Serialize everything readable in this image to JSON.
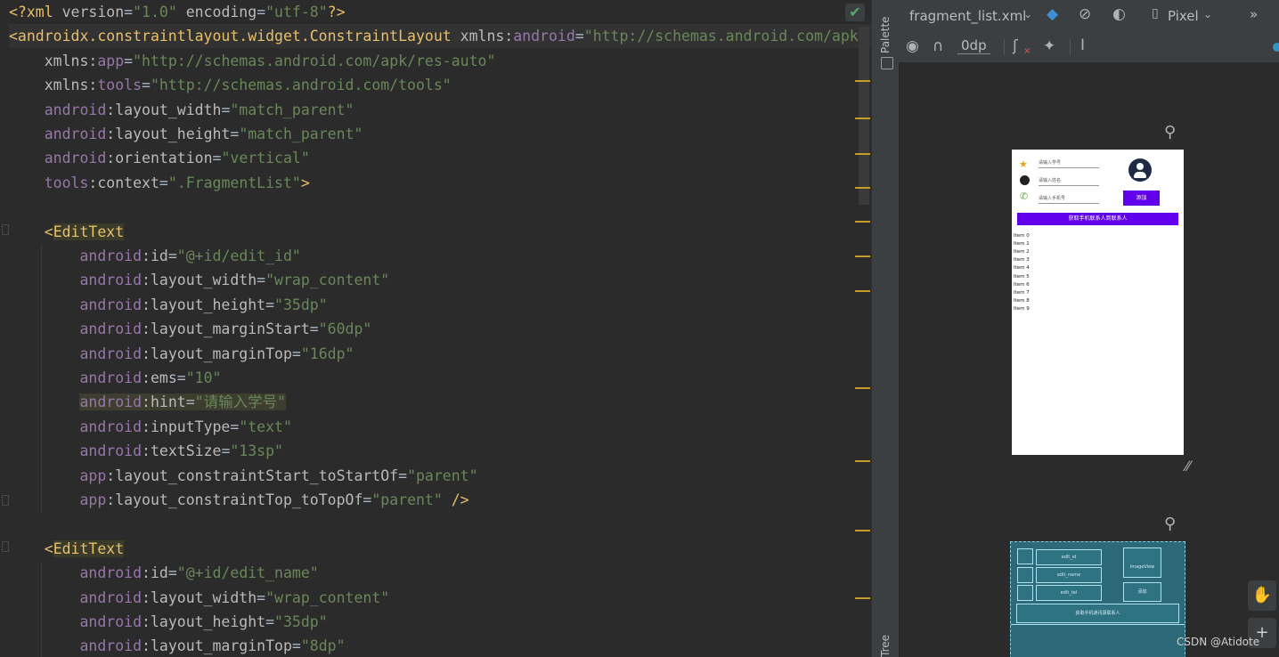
{
  "editor": {
    "lines": [
      {
        "parts": [
          [
            "tag",
            "<?xml "
          ],
          [
            "attr",
            "version"
          ],
          [
            "eq",
            "="
          ],
          [
            "val",
            "\"1.0\""
          ],
          [
            "eq",
            " "
          ],
          [
            "attr",
            "encoding"
          ],
          [
            "eq",
            "="
          ],
          [
            "val",
            "\"utf-8\""
          ],
          [
            "tag",
            "?>"
          ]
        ]
      },
      {
        "parts": [
          [
            "tag",
            "<androidx.constraintlayout.widget.ConstraintLayout "
          ],
          [
            "attr",
            "xmlns:"
          ],
          [
            "ns",
            "android"
          ],
          [
            "eq",
            "="
          ],
          [
            "val",
            "\"http://schemas.android.com/apk/"
          ]
        ]
      },
      {
        "parts": [
          [
            "eq",
            "    "
          ],
          [
            "attr",
            "xmlns:"
          ],
          [
            "ns",
            "app"
          ],
          [
            "eq",
            "="
          ],
          [
            "val",
            "\"http://schemas.android.com/apk/res-auto\""
          ]
        ]
      },
      {
        "parts": [
          [
            "eq",
            "    "
          ],
          [
            "attr",
            "xmlns:"
          ],
          [
            "ns",
            "tools"
          ],
          [
            "eq",
            "="
          ],
          [
            "val",
            "\"http://schemas.android.com/tools\""
          ]
        ]
      },
      {
        "parts": [
          [
            "eq",
            "    "
          ],
          [
            "ns",
            "android"
          ],
          [
            "attr",
            ":layout_width"
          ],
          [
            "eq",
            "="
          ],
          [
            "val",
            "\"match_parent\""
          ]
        ]
      },
      {
        "parts": [
          [
            "eq",
            "    "
          ],
          [
            "ns",
            "android"
          ],
          [
            "attr",
            ":layout_height"
          ],
          [
            "eq",
            "="
          ],
          [
            "val",
            "\"match_parent\""
          ]
        ]
      },
      {
        "parts": [
          [
            "eq",
            "    "
          ],
          [
            "ns",
            "android"
          ],
          [
            "attr",
            ":orientation"
          ],
          [
            "eq",
            "="
          ],
          [
            "val",
            "\"vertical\""
          ]
        ]
      },
      {
        "parts": [
          [
            "eq",
            "    "
          ],
          [
            "ns",
            "tools"
          ],
          [
            "attr",
            ":context"
          ],
          [
            "eq",
            "="
          ],
          [
            "val",
            "\".FragmentList\""
          ],
          [
            "tag",
            ">"
          ]
        ]
      },
      {
        "parts": []
      },
      {
        "parts": [
          [
            "eq",
            "    "
          ],
          [
            "tag",
            "<"
          ],
          [
            "tagname-hl",
            "EditText"
          ]
        ]
      },
      {
        "parts": [
          [
            "eq",
            "        "
          ],
          [
            "ns",
            "android"
          ],
          [
            "attr",
            ":id"
          ],
          [
            "eq",
            "="
          ],
          [
            "val",
            "\"@+id/edit_id\""
          ]
        ]
      },
      {
        "parts": [
          [
            "eq",
            "        "
          ],
          [
            "ns",
            "android"
          ],
          [
            "attr",
            ":layout_width"
          ],
          [
            "eq",
            "="
          ],
          [
            "val",
            "\"wrap_content\""
          ]
        ]
      },
      {
        "parts": [
          [
            "eq",
            "        "
          ],
          [
            "ns",
            "android"
          ],
          [
            "attr",
            ":layout_height"
          ],
          [
            "eq",
            "="
          ],
          [
            "val",
            "\"35dp\""
          ]
        ]
      },
      {
        "parts": [
          [
            "eq",
            "        "
          ],
          [
            "ns",
            "android"
          ],
          [
            "attr",
            ":layout_marginStart"
          ],
          [
            "eq",
            "="
          ],
          [
            "val",
            "\"60dp\""
          ]
        ]
      },
      {
        "parts": [
          [
            "eq",
            "        "
          ],
          [
            "ns",
            "android"
          ],
          [
            "attr",
            ":layout_marginTop"
          ],
          [
            "eq",
            "="
          ],
          [
            "val",
            "\"16dp\""
          ]
        ]
      },
      {
        "parts": [
          [
            "eq",
            "        "
          ],
          [
            "ns",
            "android"
          ],
          [
            "attr",
            ":ems"
          ],
          [
            "eq",
            "="
          ],
          [
            "val",
            "\"10\""
          ]
        ]
      },
      {
        "parts": [
          [
            "eq",
            "        "
          ],
          [
            "ns hint-hl",
            "android"
          ],
          [
            "attr hint-hl",
            ":hint"
          ],
          [
            "eq hint-hl",
            "="
          ],
          [
            "val hint-hl",
            "\"请输入学号\""
          ]
        ]
      },
      {
        "parts": [
          [
            "eq",
            "        "
          ],
          [
            "ns",
            "android"
          ],
          [
            "attr",
            ":inputType"
          ],
          [
            "eq",
            "="
          ],
          [
            "val",
            "\"text\""
          ]
        ]
      },
      {
        "parts": [
          [
            "eq",
            "        "
          ],
          [
            "ns",
            "android"
          ],
          [
            "attr",
            ":textSize"
          ],
          [
            "eq",
            "="
          ],
          [
            "val",
            "\"13sp\""
          ]
        ]
      },
      {
        "parts": [
          [
            "eq",
            "        "
          ],
          [
            "ns",
            "app"
          ],
          [
            "attr",
            ":layout_constraintStart_toStartOf"
          ],
          [
            "eq",
            "="
          ],
          [
            "val",
            "\"parent\""
          ]
        ]
      },
      {
        "parts": [
          [
            "eq",
            "        "
          ],
          [
            "ns",
            "app"
          ],
          [
            "attr",
            ":layout_constraintTop_toTopOf"
          ],
          [
            "eq",
            "="
          ],
          [
            "val",
            "\"parent\""
          ],
          [
            "eq",
            " "
          ],
          [
            "tag",
            "/>"
          ]
        ]
      },
      {
        "parts": []
      },
      {
        "parts": [
          [
            "eq",
            "    "
          ],
          [
            "tag",
            "<"
          ],
          [
            "tagname-hl",
            "EditText"
          ]
        ]
      },
      {
        "parts": [
          [
            "eq",
            "        "
          ],
          [
            "ns",
            "android"
          ],
          [
            "attr",
            ":id"
          ],
          [
            "eq",
            "="
          ],
          [
            "val",
            "\"@+id/edit_name\""
          ]
        ]
      },
      {
        "parts": [
          [
            "eq",
            "        "
          ],
          [
            "ns",
            "android"
          ],
          [
            "attr",
            ":layout_width"
          ],
          [
            "eq",
            "="
          ],
          [
            "val",
            "\"wrap_content\""
          ]
        ]
      },
      {
        "parts": [
          [
            "eq",
            "        "
          ],
          [
            "ns",
            "android"
          ],
          [
            "attr",
            ":layout_height"
          ],
          [
            "eq",
            "="
          ],
          [
            "val",
            "\"35dp\""
          ]
        ]
      },
      {
        "parts": [
          [
            "eq",
            "        "
          ],
          [
            "ns",
            "android"
          ],
          [
            "attr",
            ":layout_marginTop"
          ],
          [
            "eq",
            "="
          ],
          [
            "val",
            "\"8dp\""
          ]
        ]
      }
    ]
  },
  "sidebar": {
    "palette_label": "Palette",
    "tree_label": "Tree"
  },
  "design_toolbar": {
    "file_name": "fragment_list.xml",
    "device": "Pixel",
    "margin_value": "0dp",
    "overflow": "»"
  },
  "phone_preview": {
    "hint_id": "请输入学号",
    "hint_name": "请输入姓名",
    "hint_tel": "请输入手机号",
    "add_button": "添加",
    "import_button": "获取手机联系人到联系人",
    "items": [
      "Item 0",
      "Item 1",
      "Item 2",
      "Item 3",
      "Item 4",
      "Item 5",
      "Item 6",
      "Item 7",
      "Item 8",
      "Item 9"
    ]
  },
  "blueprint": {
    "edit_id": "edit_id",
    "edit_name": "edit_name",
    "edit_tel": "edit_tel",
    "image_view": "ImageView",
    "add_button": "添加",
    "import_button": "获取手机通讯录联系人"
  },
  "watermark": "CSDN @Atidote"
}
